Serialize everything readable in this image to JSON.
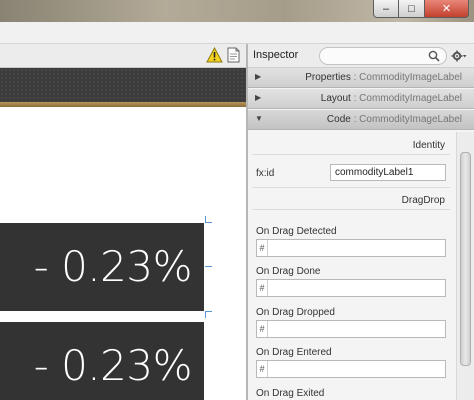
{
  "window": {
    "controls": {
      "minimize": "–",
      "maximize": "□",
      "close": "✕"
    }
  },
  "canvas": {
    "values": [
      "- 0.23%",
      "- 0.23%"
    ],
    "colors": {
      "box": "#333333",
      "text": "#ffffff",
      "selection_handle": "#5a93d6"
    }
  },
  "inspector": {
    "title": "Inspector",
    "search_placeholder": "",
    "sections": [
      {
        "label": "Properties",
        "kind": "CommodityImageLabel",
        "expanded": false
      },
      {
        "label": "Layout",
        "kind": "CommodityImageLabel",
        "expanded": false
      },
      {
        "label": "Code",
        "kind": "CommodityImageLabel",
        "expanded": true
      }
    ],
    "separator": " : ",
    "arrows": {
      "collapsed": "▶",
      "expanded": "▼"
    },
    "groups": {
      "identity": "Identity",
      "dragdrop": "DragDrop"
    },
    "fxid": {
      "label": "fx:id",
      "value": "commodityLabel1"
    },
    "handlers": [
      {
        "label": "On Drag Detected",
        "prefix": "#",
        "value": ""
      },
      {
        "label": "On Drag Done",
        "prefix": "#",
        "value": ""
      },
      {
        "label": "On Drag Dropped",
        "prefix": "#",
        "value": ""
      },
      {
        "label": "On Drag Entered",
        "prefix": "#",
        "value": ""
      },
      {
        "label": "On Drag Exited",
        "prefix": "#",
        "value": ""
      }
    ]
  },
  "icons": {
    "warning": "warning-icon",
    "document": "document-icon",
    "search": "search-icon",
    "gear": "gear-icon"
  }
}
